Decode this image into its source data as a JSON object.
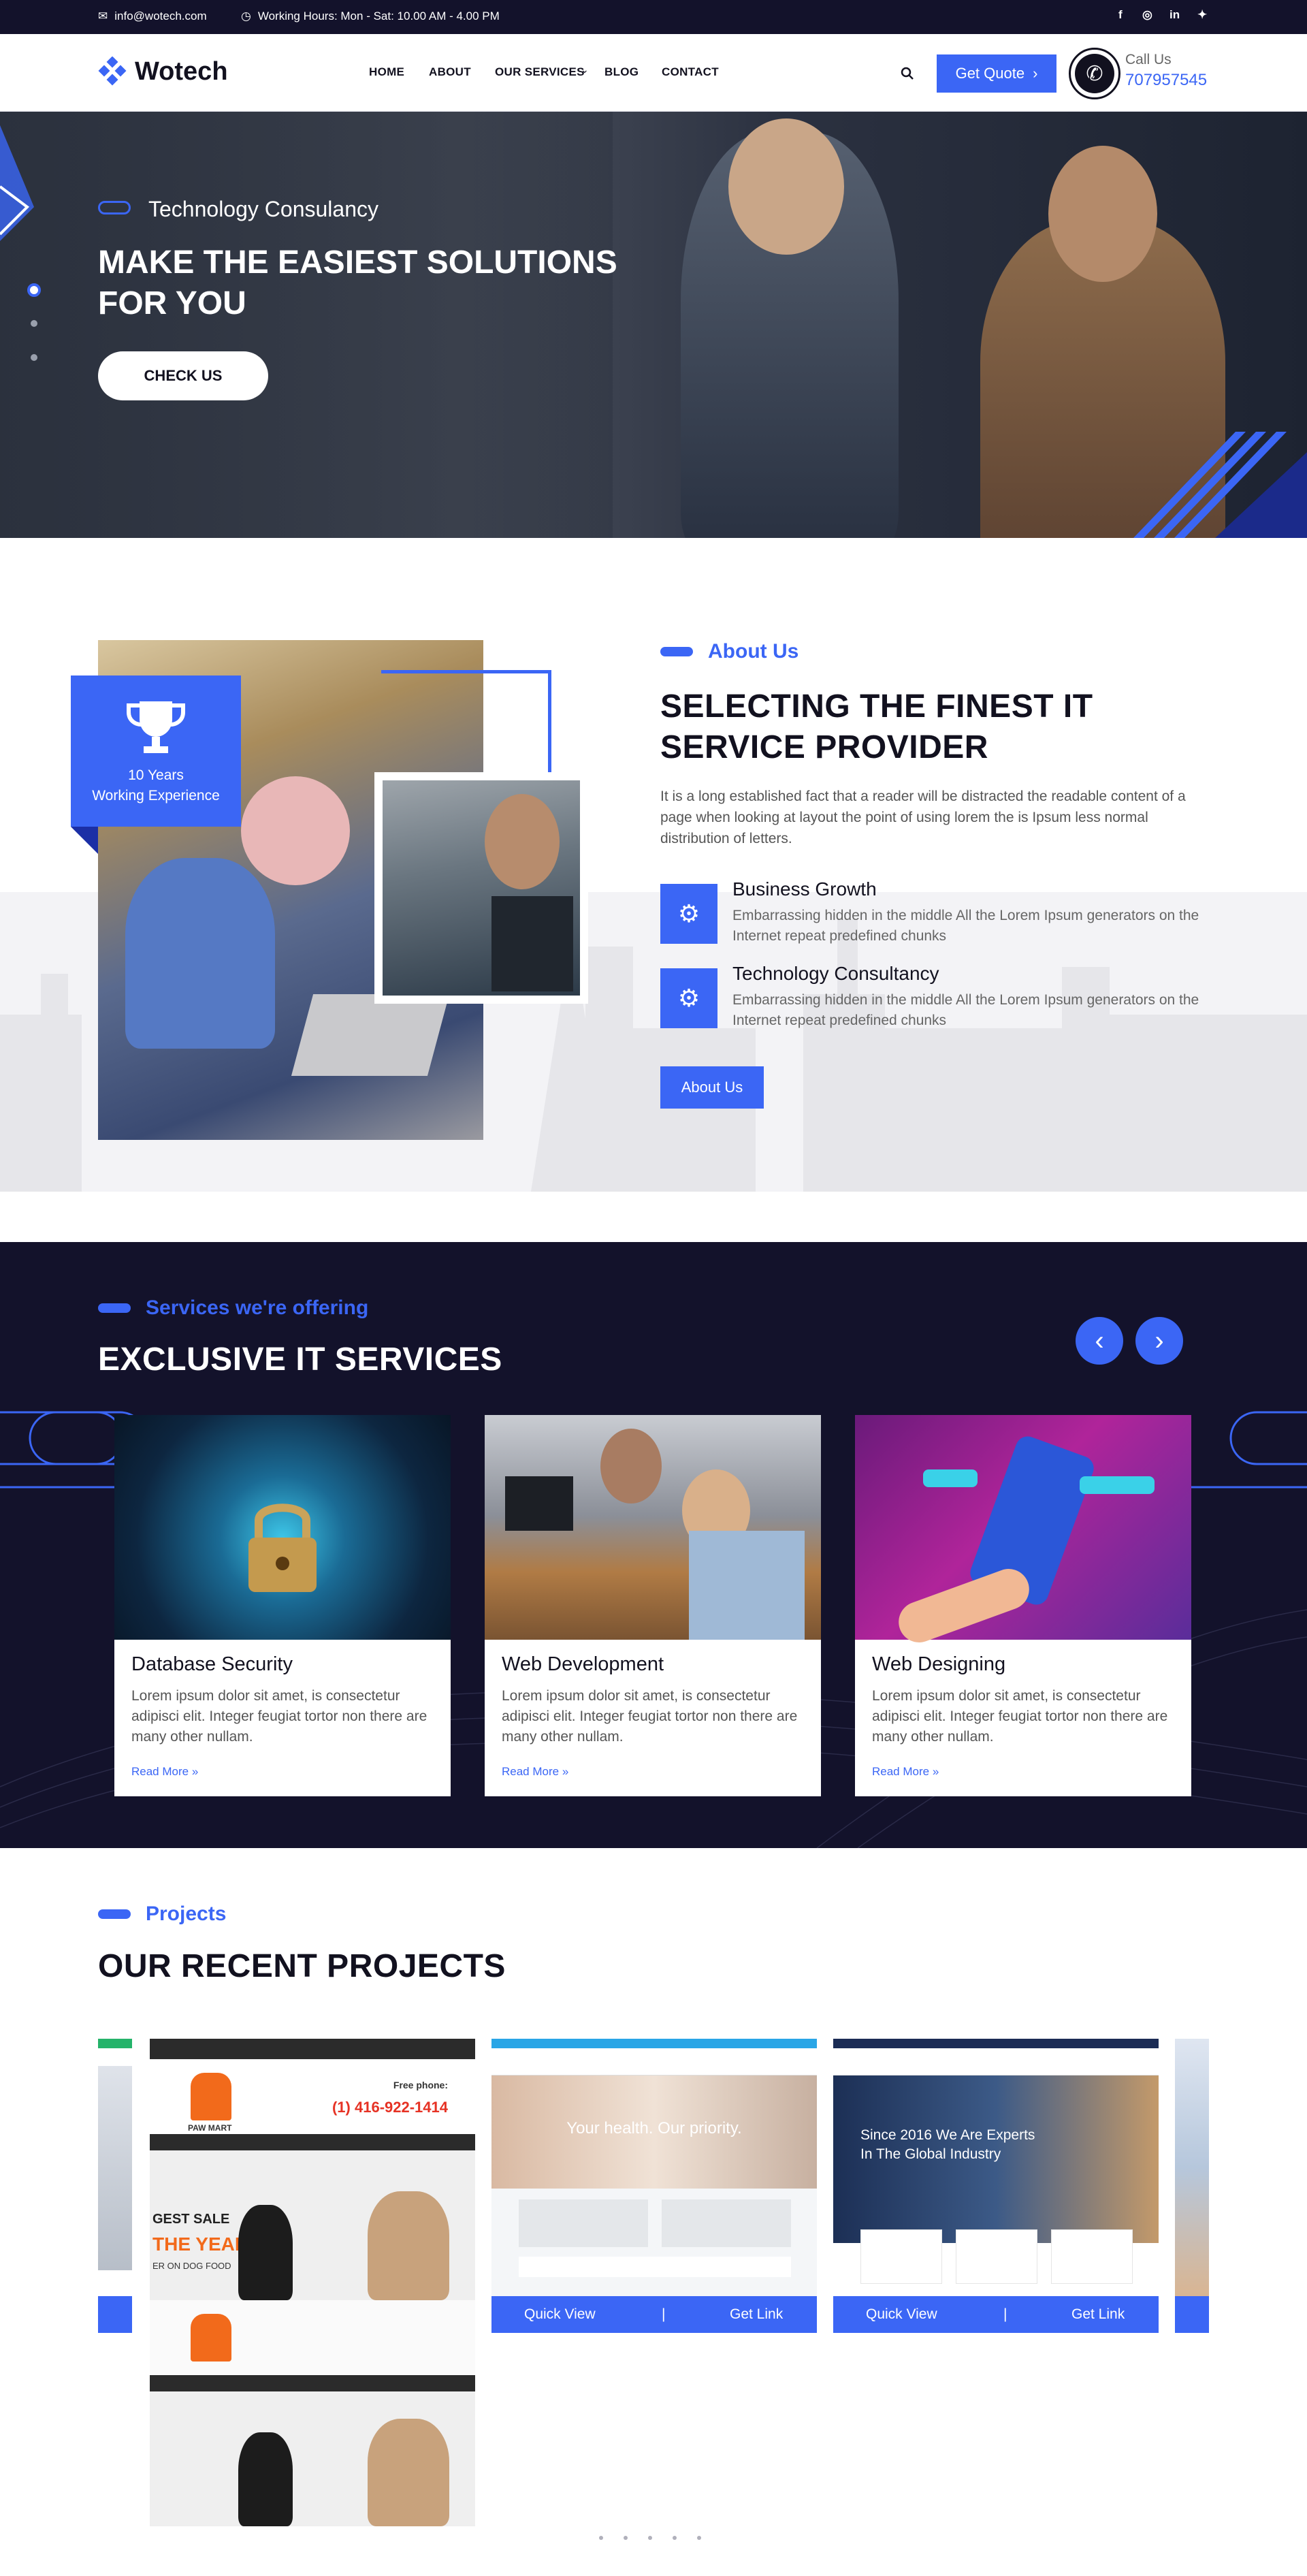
{
  "topbar": {
    "email": "info@wotech.com",
    "hours": "Working Hours: Mon - Sat: 10.00 AM - 4.00 PM",
    "social": [
      "f",
      "ig",
      "in",
      "tw"
    ]
  },
  "header": {
    "logo": "Wotech",
    "nav": [
      "HOME",
      "ABOUT",
      "OUR SERVICES",
      "BLOG",
      "CONTACT"
    ],
    "quote_label": "Get Quote",
    "call_label": "Call Us",
    "call_number": "707957545"
  },
  "hero": {
    "eyebrow": "Technology Consulancy",
    "title_line1": "MAKE THE EASIEST SOLUTIONS",
    "title_line2": "FOR YOU",
    "button": "CHECK US"
  },
  "about": {
    "badge_years": "10 Years",
    "badge_text": "Working Experience",
    "eyebrow": "About Us",
    "title_line1": "SELECTING THE FINEST IT",
    "title_line2": "SERVICE PROVIDER",
    "intro": "It is a long established fact that a reader will be distracted the readable content of a page when looking at layout the point of using lorem the is Ipsum less normal distribution of letters.",
    "features": [
      {
        "title": "Business Growth",
        "text": "Embarrassing hidden in the middle All the Lorem Ipsum generators on the Internet repeat predefined chunks"
      },
      {
        "title": "Technology Consultancy",
        "text": "Embarrassing hidden in the middle All the Lorem Ipsum generators on the Internet repeat predefined chunks"
      }
    ],
    "button": "About Us"
  },
  "services": {
    "eyebrow": "Services we're offering",
    "title": "EXCLUSIVE IT SERVICES",
    "cards": [
      {
        "title": "Database Security",
        "text": "Lorem ipsum dolor sit amet, is consectetur adipisci elit. Integer feugiat tortor non there are many other nullam.",
        "link": "Read More »"
      },
      {
        "title": "Web Development",
        "text": "Lorem ipsum dolor sit amet, is consectetur adipisci elit. Integer feugiat tortor non there are many other nullam.",
        "link": "Read More »"
      },
      {
        "title": "Web Designing",
        "text": "Lorem ipsum dolor sit amet, is consectetur adipisci elit. Integer feugiat tortor non there are many other nullam.",
        "link": "Read More »"
      }
    ]
  },
  "projects": {
    "eyebrow": "Projects",
    "title": "OUR RECENT PROJECTS",
    "items": [
      {
        "phone_label": "Free phone:",
        "phone": "(1) 416-922-1414",
        "sale1": "GEST SALE",
        "sale2": "THE YEAR",
        "sale3": "ER ON DOG FOOD",
        "brand": "PAW MART"
      },
      {
        "headline": "Your health. Our priority.",
        "quick": "Quick View",
        "link": "Get Link"
      },
      {
        "headline1": "Since 2016 We Are Experts",
        "headline2": "In The Global Industry",
        "quick": "Quick View",
        "link": "Get Link"
      }
    ]
  }
}
